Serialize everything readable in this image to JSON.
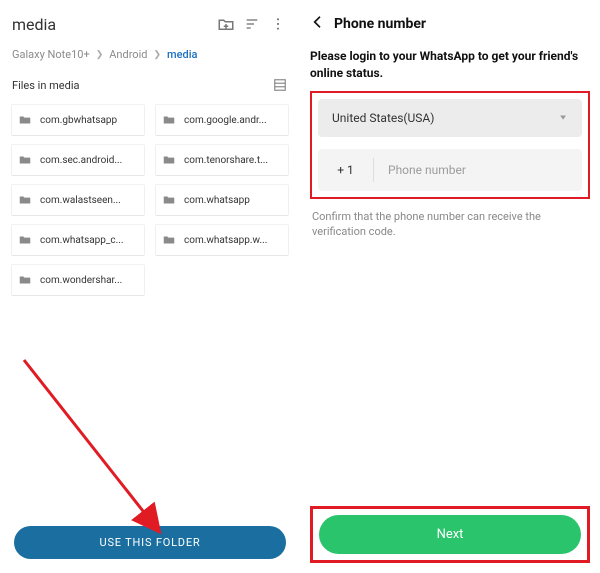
{
  "left": {
    "title": "media",
    "breadcrumbs": {
      "a": "Galaxy Note10+",
      "b": "Android",
      "c": "media"
    },
    "files_label": "Files in media",
    "folders": {
      "f0": "com.gbwhatsapp",
      "f1": "com.google.andr...",
      "f2": "com.sec.android...",
      "f3": "com.tenorshare.t...",
      "f4": "com.walastseen...",
      "f5": "com.whatsapp",
      "f6": "com.whatsapp_c...",
      "f7": "com.whatsapp.w...",
      "f8": "com.wondershar..."
    },
    "use_folder_label": "USE THIS FOLDER"
  },
  "right": {
    "title": "Phone number",
    "message": "Please login to your WhatsApp to get your friend's online status.",
    "country": "United States(USA)",
    "dial_code": "+ 1",
    "phone_placeholder": "Phone number",
    "confirm": "Confirm that the phone number can receive the verification code.",
    "next_label": "Next"
  }
}
